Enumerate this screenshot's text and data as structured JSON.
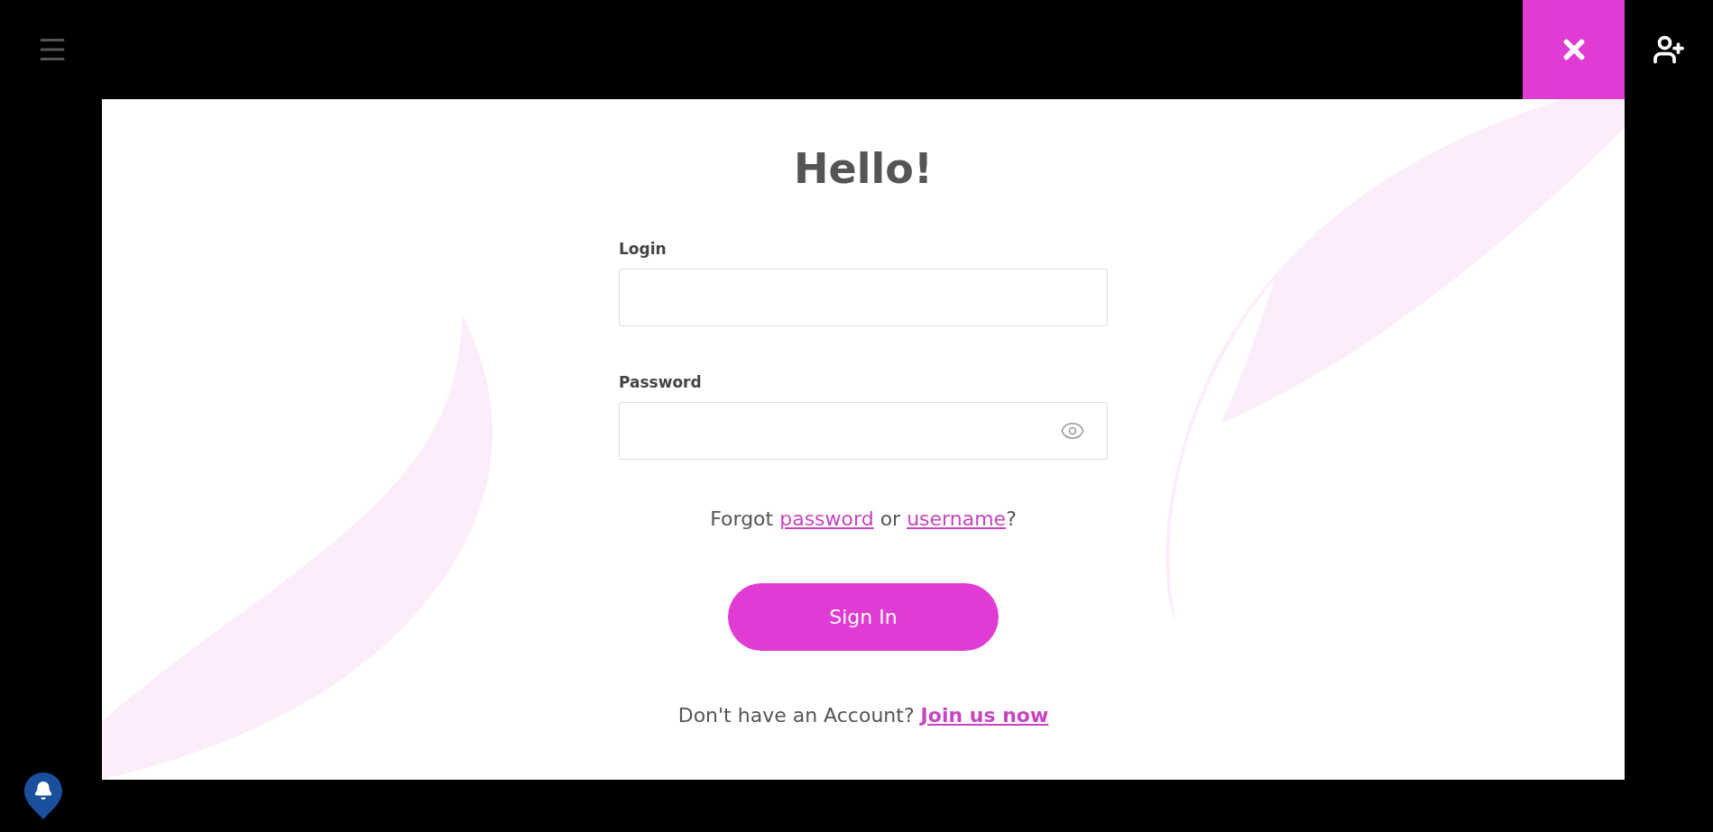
{
  "title": "Hello!",
  "fields": [
    {
      "label": "Login",
      "kind": "text"
    },
    {
      "label": "Password",
      "kind": "password"
    }
  ],
  "forgot": {
    "before": "Forgot",
    "link_1": "password",
    "middle": "or",
    "link_2": "username",
    "after": "?"
  },
  "submit": "Sign In",
  "signup": {
    "text": "Don't have an Account?",
    "link": "Join us now"
  }
}
